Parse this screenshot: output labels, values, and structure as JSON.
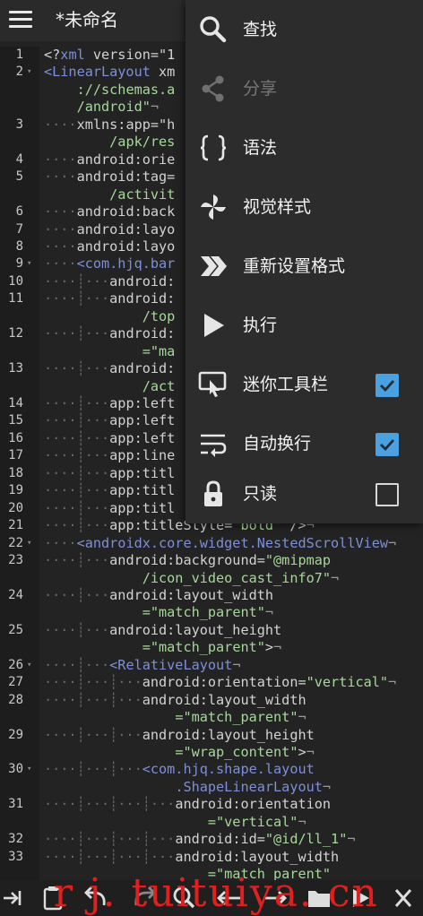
{
  "header": {
    "menu_icon": "hamburger-icon",
    "title": "*未命名"
  },
  "menu": {
    "items": [
      {
        "label": "查找",
        "icon": "search-icon"
      },
      {
        "label": "分享",
        "icon": "share-icon",
        "disabled": true
      },
      {
        "label": "语法",
        "icon": "braces-icon"
      },
      {
        "label": "视觉样式",
        "icon": "pinwheel-icon"
      },
      {
        "label": "重新设置格式",
        "icon": "double-chevron-icon"
      },
      {
        "label": "执行",
        "icon": "play-icon"
      },
      {
        "label": "迷你工具栏",
        "icon": "touch-toolbar-icon",
        "checked": true
      },
      {
        "label": "自动换行",
        "icon": "wrap-icon",
        "checked": true
      },
      {
        "label": "只读",
        "icon": "lock-icon",
        "checked": false
      }
    ],
    "checkbox_color": "#4aa0e0"
  },
  "editor": {
    "lines": [
      {
        "n": "1",
        "fold": "",
        "parts": [
          [
            "p",
            "<?"
          ],
          [
            "tag",
            "xml"
          ],
          [
            "attr",
            " version=\"1"
          ]
        ]
      },
      {
        "n": "2",
        "fold": "▾",
        "parts": [
          [
            "tag",
            "<LinearLayout"
          ],
          [
            "attr",
            " xm"
          ]
        ]
      },
      {
        "n": "",
        "fold": "",
        "parts": [
          [
            "d",
            "    "
          ],
          [
            "val",
            "://schemas.a"
          ]
        ]
      },
      {
        "n": "",
        "fold": "",
        "parts": [
          [
            "d",
            "    "
          ],
          [
            "val",
            "/android\""
          ],
          [
            "g",
            "¬"
          ]
        ]
      },
      {
        "n": "3",
        "fold": "",
        "parts": [
          [
            "d",
            "····"
          ],
          [
            "attr",
            "xmlns:app=\"h"
          ]
        ]
      },
      {
        "n": "",
        "fold": "",
        "parts": [
          [
            "d",
            "        "
          ],
          [
            "val",
            "/apk/res"
          ]
        ]
      },
      {
        "n": "4",
        "fold": "",
        "parts": [
          [
            "d",
            "····"
          ],
          [
            "attr",
            "android:orie"
          ]
        ]
      },
      {
        "n": "5",
        "fold": "",
        "parts": [
          [
            "d",
            "····"
          ],
          [
            "attr",
            "android:tag="
          ]
        ]
      },
      {
        "n": "",
        "fold": "",
        "parts": [
          [
            "d",
            "        "
          ],
          [
            "val",
            "/activit"
          ]
        ]
      },
      {
        "n": "6",
        "fold": "",
        "parts": [
          [
            "d",
            "····"
          ],
          [
            "attr",
            "android:back"
          ]
        ]
      },
      {
        "n": "7",
        "fold": "",
        "parts": [
          [
            "d",
            "····"
          ],
          [
            "attr",
            "android:layo"
          ]
        ]
      },
      {
        "n": "8",
        "fold": "",
        "parts": [
          [
            "d",
            "····"
          ],
          [
            "attr",
            "android:layo"
          ]
        ]
      },
      {
        "n": "9",
        "fold": "▾",
        "parts": [
          [
            "d",
            "····"
          ],
          [
            "tag",
            "<com.hjq.bar"
          ]
        ]
      },
      {
        "n": "10",
        "fold": "",
        "parts": [
          [
            "d",
            "····┊···"
          ],
          [
            "attr",
            "android:"
          ]
        ]
      },
      {
        "n": "11",
        "fold": "",
        "parts": [
          [
            "d",
            "····┊···"
          ],
          [
            "attr",
            "android:"
          ]
        ]
      },
      {
        "n": "",
        "fold": "",
        "parts": [
          [
            "d",
            "            "
          ],
          [
            "val",
            "/top"
          ]
        ]
      },
      {
        "n": "12",
        "fold": "",
        "parts": [
          [
            "d",
            "····┊···"
          ],
          [
            "attr",
            "android:"
          ]
        ]
      },
      {
        "n": "",
        "fold": "",
        "parts": [
          [
            "d",
            "            "
          ],
          [
            "val",
            "=\"ma"
          ]
        ]
      },
      {
        "n": "13",
        "fold": "",
        "parts": [
          [
            "d",
            "····┊···"
          ],
          [
            "attr",
            "android:"
          ]
        ]
      },
      {
        "n": "",
        "fold": "",
        "parts": [
          [
            "d",
            "            "
          ],
          [
            "val",
            "/act"
          ]
        ]
      },
      {
        "n": "14",
        "fold": "",
        "parts": [
          [
            "d",
            "····┊···"
          ],
          [
            "attr",
            "app:left"
          ]
        ]
      },
      {
        "n": "15",
        "fold": "",
        "parts": [
          [
            "d",
            "····┊···"
          ],
          [
            "attr",
            "app:left"
          ]
        ]
      },
      {
        "n": "16",
        "fold": "",
        "parts": [
          [
            "d",
            "····┊···"
          ],
          [
            "attr",
            "app:left"
          ]
        ]
      },
      {
        "n": "17",
        "fold": "",
        "parts": [
          [
            "d",
            "····┊···"
          ],
          [
            "attr",
            "app:line"
          ]
        ]
      },
      {
        "n": "18",
        "fold": "",
        "parts": [
          [
            "d",
            "····┊···"
          ],
          [
            "attr",
            "app:titl"
          ]
        ]
      },
      {
        "n": "19",
        "fold": "",
        "parts": [
          [
            "d",
            "····┊···"
          ],
          [
            "attr",
            "app:titl"
          ]
        ]
      },
      {
        "n": "20",
        "fold": "",
        "parts": [
          [
            "d",
            "····┊···"
          ],
          [
            "attr",
            "app:titl"
          ]
        ]
      },
      {
        "n": "21",
        "fold": "",
        "parts": [
          [
            "d",
            "····┊···"
          ],
          [
            "attr",
            "app:titleStyle="
          ],
          [
            "val",
            "\"bold\""
          ],
          [
            "p",
            " />"
          ],
          [
            "g",
            "¬"
          ]
        ]
      },
      {
        "n": "22",
        "fold": "▾",
        "parts": [
          [
            "d",
            "····"
          ],
          [
            "tag",
            "<androidx.core.widget.NestedScrollView"
          ],
          [
            "g",
            "¬"
          ]
        ]
      },
      {
        "n": "23",
        "fold": "",
        "parts": [
          [
            "d",
            "····┊···"
          ],
          [
            "attr",
            "android:background="
          ],
          [
            "val",
            "\"@mipmap"
          ]
        ]
      },
      {
        "n": "",
        "fold": "",
        "parts": [
          [
            "d",
            "            "
          ],
          [
            "val",
            "/icon_video_cast_info7\""
          ],
          [
            "g",
            "¬"
          ]
        ]
      },
      {
        "n": "24",
        "fold": "",
        "parts": [
          [
            "d",
            "····┊···"
          ],
          [
            "attr",
            "android:layout_width"
          ]
        ]
      },
      {
        "n": "",
        "fold": "",
        "parts": [
          [
            "d",
            "            "
          ],
          [
            "val",
            "=\"match_parent\""
          ],
          [
            "g",
            "¬"
          ]
        ]
      },
      {
        "n": "25",
        "fold": "",
        "parts": [
          [
            "d",
            "····┊···"
          ],
          [
            "attr",
            "android:layout_height"
          ]
        ]
      },
      {
        "n": "",
        "fold": "",
        "parts": [
          [
            "d",
            "            "
          ],
          [
            "val",
            "=\"match_parent\""
          ],
          [
            "p",
            ">"
          ],
          [
            "g",
            "¬"
          ]
        ]
      },
      {
        "n": "26",
        "fold": "▾",
        "parts": [
          [
            "d",
            "····┊···"
          ],
          [
            "tag",
            "<RelativeLayout"
          ],
          [
            "g",
            "¬"
          ]
        ]
      },
      {
        "n": "27",
        "fold": "",
        "parts": [
          [
            "d",
            "····┊···┊···"
          ],
          [
            "attr",
            "android:orientation="
          ],
          [
            "val",
            "\"vertical\""
          ],
          [
            "g",
            "¬"
          ]
        ]
      },
      {
        "n": "28",
        "fold": "",
        "parts": [
          [
            "d",
            "····┊···┊···"
          ],
          [
            "attr",
            "android:layout_width"
          ]
        ]
      },
      {
        "n": "",
        "fold": "",
        "parts": [
          [
            "d",
            "                "
          ],
          [
            "val",
            "=\"match_parent\""
          ],
          [
            "g",
            "¬"
          ]
        ]
      },
      {
        "n": "29",
        "fold": "",
        "parts": [
          [
            "d",
            "····┊···┊···"
          ],
          [
            "attr",
            "android:layout_height"
          ]
        ]
      },
      {
        "n": "",
        "fold": "",
        "parts": [
          [
            "d",
            "                "
          ],
          [
            "val",
            "=\"wrap_content\""
          ],
          [
            "p",
            ">"
          ],
          [
            "g",
            "¬"
          ]
        ]
      },
      {
        "n": "30",
        "fold": "▾",
        "parts": [
          [
            "d",
            "····┊···┊···"
          ],
          [
            "tag",
            "<com.hjq.shape.layout"
          ]
        ]
      },
      {
        "n": "",
        "fold": "",
        "parts": [
          [
            "d",
            "                "
          ],
          [
            "tag",
            ".ShapeLinearLayout"
          ],
          [
            "g",
            "¬"
          ]
        ]
      },
      {
        "n": "31",
        "fold": "",
        "parts": [
          [
            "d",
            "····┊···┊···┊···"
          ],
          [
            "attr",
            "android:orientation"
          ]
        ]
      },
      {
        "n": "",
        "fold": "",
        "parts": [
          [
            "d",
            "                    "
          ],
          [
            "val",
            "=\"vertical\""
          ],
          [
            "g",
            "¬"
          ]
        ]
      },
      {
        "n": "32",
        "fold": "",
        "parts": [
          [
            "d",
            "····┊···┊···┊···"
          ],
          [
            "attr",
            "android:id="
          ],
          [
            "val",
            "\"@id/ll_1\""
          ],
          [
            "g",
            "¬"
          ]
        ]
      },
      {
        "n": "33",
        "fold": "",
        "parts": [
          [
            "d",
            "····┊···┊···┊···"
          ],
          [
            "attr",
            "android:layout_width"
          ]
        ]
      },
      {
        "n": "",
        "fold": "",
        "parts": [
          [
            "d",
            "                    "
          ],
          [
            "val",
            "=\"match_parent\""
          ]
        ]
      }
    ]
  },
  "toolbar": {
    "icons": [
      "tab-indent-icon",
      "clipboard-icon",
      "undo-icon",
      "redo-icon",
      "search-icon",
      "arrow-left-icon",
      "arrow-right-icon",
      "save-icon",
      "play-icon",
      "close-icon"
    ]
  },
  "watermark": "r j. tuituiya. cn"
}
